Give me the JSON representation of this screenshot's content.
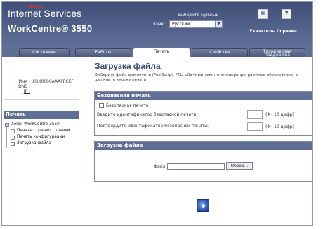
{
  "header": {
    "brand_small": "Xerox",
    "brand_title": "Internet Services",
    "model": "WorkCentre® 3550",
    "language_caption": "Выберите нужный",
    "language_label": "язык :",
    "language_value": "Русский",
    "index_label": "Указатель",
    "help_label": "Справка",
    "index_icon": "index-icon",
    "help_icon": "help-icon"
  },
  "tabs": [
    {
      "label": "Состояние"
    },
    {
      "label": "Работы"
    },
    {
      "label": "Печать"
    },
    {
      "label": "Свойства"
    },
    {
      "label": "Техническая поддержка"
    }
  ],
  "device_info": {
    "name_key": "Имя :",
    "name_value": "XRX0000AAAFFCEF",
    "dns_key": "DNS :",
    "ip_key": "IP :"
  },
  "sidebar": {
    "heading": "Печать",
    "root": "Xerox WorkCentre 3550",
    "items": [
      {
        "label": "Печать страниц справки"
      },
      {
        "label": "Печать конфигурации"
      },
      {
        "label": "Загрузка файла"
      }
    ]
  },
  "main": {
    "title": "Загрузка файла",
    "description": "Выберите файл для печати (PostScript, PCL, обычный текст или микропрограммное обеспечение) и щелкните кнопку печати."
  },
  "secure_print": {
    "heading": "Безопасная печать",
    "checkbox_label": "Безопасная печать",
    "enter_id_label": "Введите идентификатор безопасной печати:",
    "confirm_id_label": "Подтвердите идентификатор безопасной печати:",
    "hint": "(4 - 10 цифр)"
  },
  "upload": {
    "heading": "Загрузка файла",
    "file_label": "Файл:",
    "file_value": "",
    "browse_label": "Обзор..."
  },
  "colors": {
    "header": "#5f6e95",
    "accent": "#3d4b75",
    "brand_red": "#e03020"
  }
}
